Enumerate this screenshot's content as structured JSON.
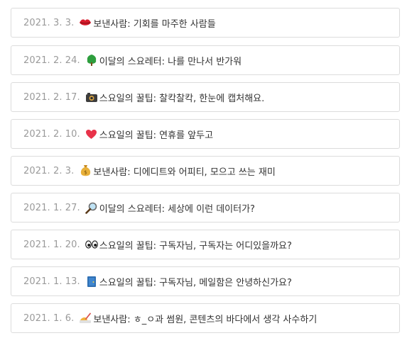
{
  "posts": [
    {
      "date": "2021. 3. 3.",
      "icon": "lips-icon",
      "title": "보낸사람: 기회를 마주한 사람들"
    },
    {
      "date": "2021. 2. 24.",
      "icon": "tree-icon",
      "title": "이달의 스요레터: 나를 만나서 반가워"
    },
    {
      "date": "2021. 2. 17.",
      "icon": "camera-icon",
      "title": "스요일의 꿀팁: 찰칵찰칵, 한눈에 캡처해요."
    },
    {
      "date": "2021. 2. 10.",
      "icon": "heart-icon",
      "title": "스요일의 꿀팁: 연휴를 앞두고"
    },
    {
      "date": "2021. 2. 3.",
      "icon": "money-bag-icon",
      "title": "보낸사람: 디에디트와 어피티, 모으고 쓰는 재미"
    },
    {
      "date": "2021. 1. 27.",
      "icon": "magnifier-icon",
      "title": "이달의 스요레터: 세상에 이런 데이터가?"
    },
    {
      "date": "2021. 1. 20.",
      "icon": "eyes-icon",
      "title": "스요일의 꿀팁: 구독자님, 구독자는 어디있을까요?"
    },
    {
      "date": "2021. 1. 13.",
      "icon": "door-icon",
      "title": "스요일의 꿀팁: 구독자님, 메일함은 안녕하신가요?"
    },
    {
      "date": "2021. 1. 6.",
      "icon": "writing-hand-icon",
      "title": "보낸사람: ㅎ_ㅇ과 썸원, 콘텐츠의 바다에서 생각 사수하기"
    }
  ]
}
